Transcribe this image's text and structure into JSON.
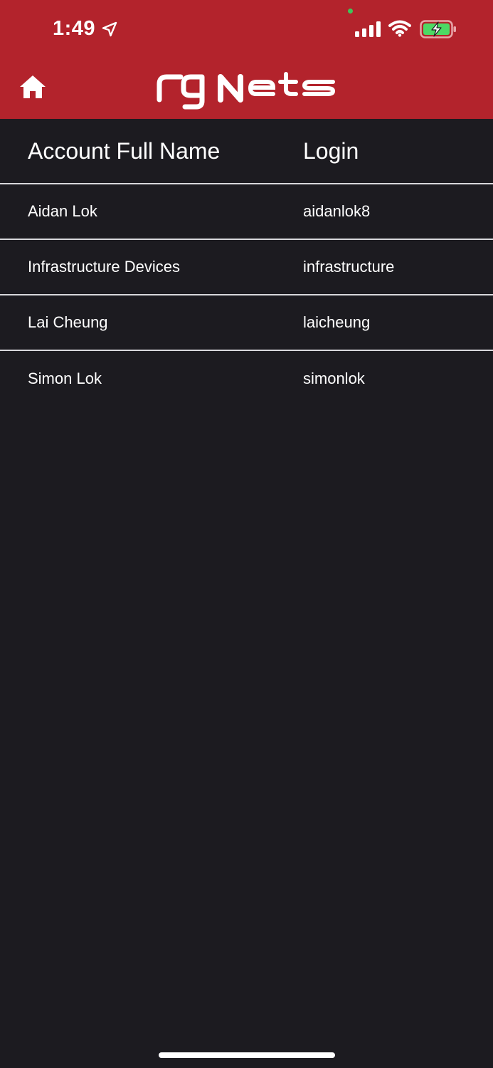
{
  "status_bar": {
    "time": "1:49",
    "location_icon": "location-arrow-icon",
    "signal_icon": "cellular-signal-icon",
    "wifi_icon": "wifi-icon",
    "battery_icon": "battery-charging-icon"
  },
  "app_bar": {
    "home_icon": "home-icon",
    "logo_text": "rgNets"
  },
  "colors": {
    "brand_red": "#b3232c",
    "background": "#1c1b20",
    "text": "#ffffff",
    "divider": "#d8d8dc",
    "battery_green": "#4cd964"
  },
  "table": {
    "columns": [
      "Account Full Name",
      "Login"
    ],
    "rows": [
      {
        "full_name": "Aidan Lok",
        "login": "aidanlok8"
      },
      {
        "full_name": "Infrastructure Devices",
        "login": "infrastructure"
      },
      {
        "full_name": "Lai Cheung",
        "login": "laicheung"
      },
      {
        "full_name": "Simon Lok",
        "login": "simonlok"
      }
    ]
  }
}
